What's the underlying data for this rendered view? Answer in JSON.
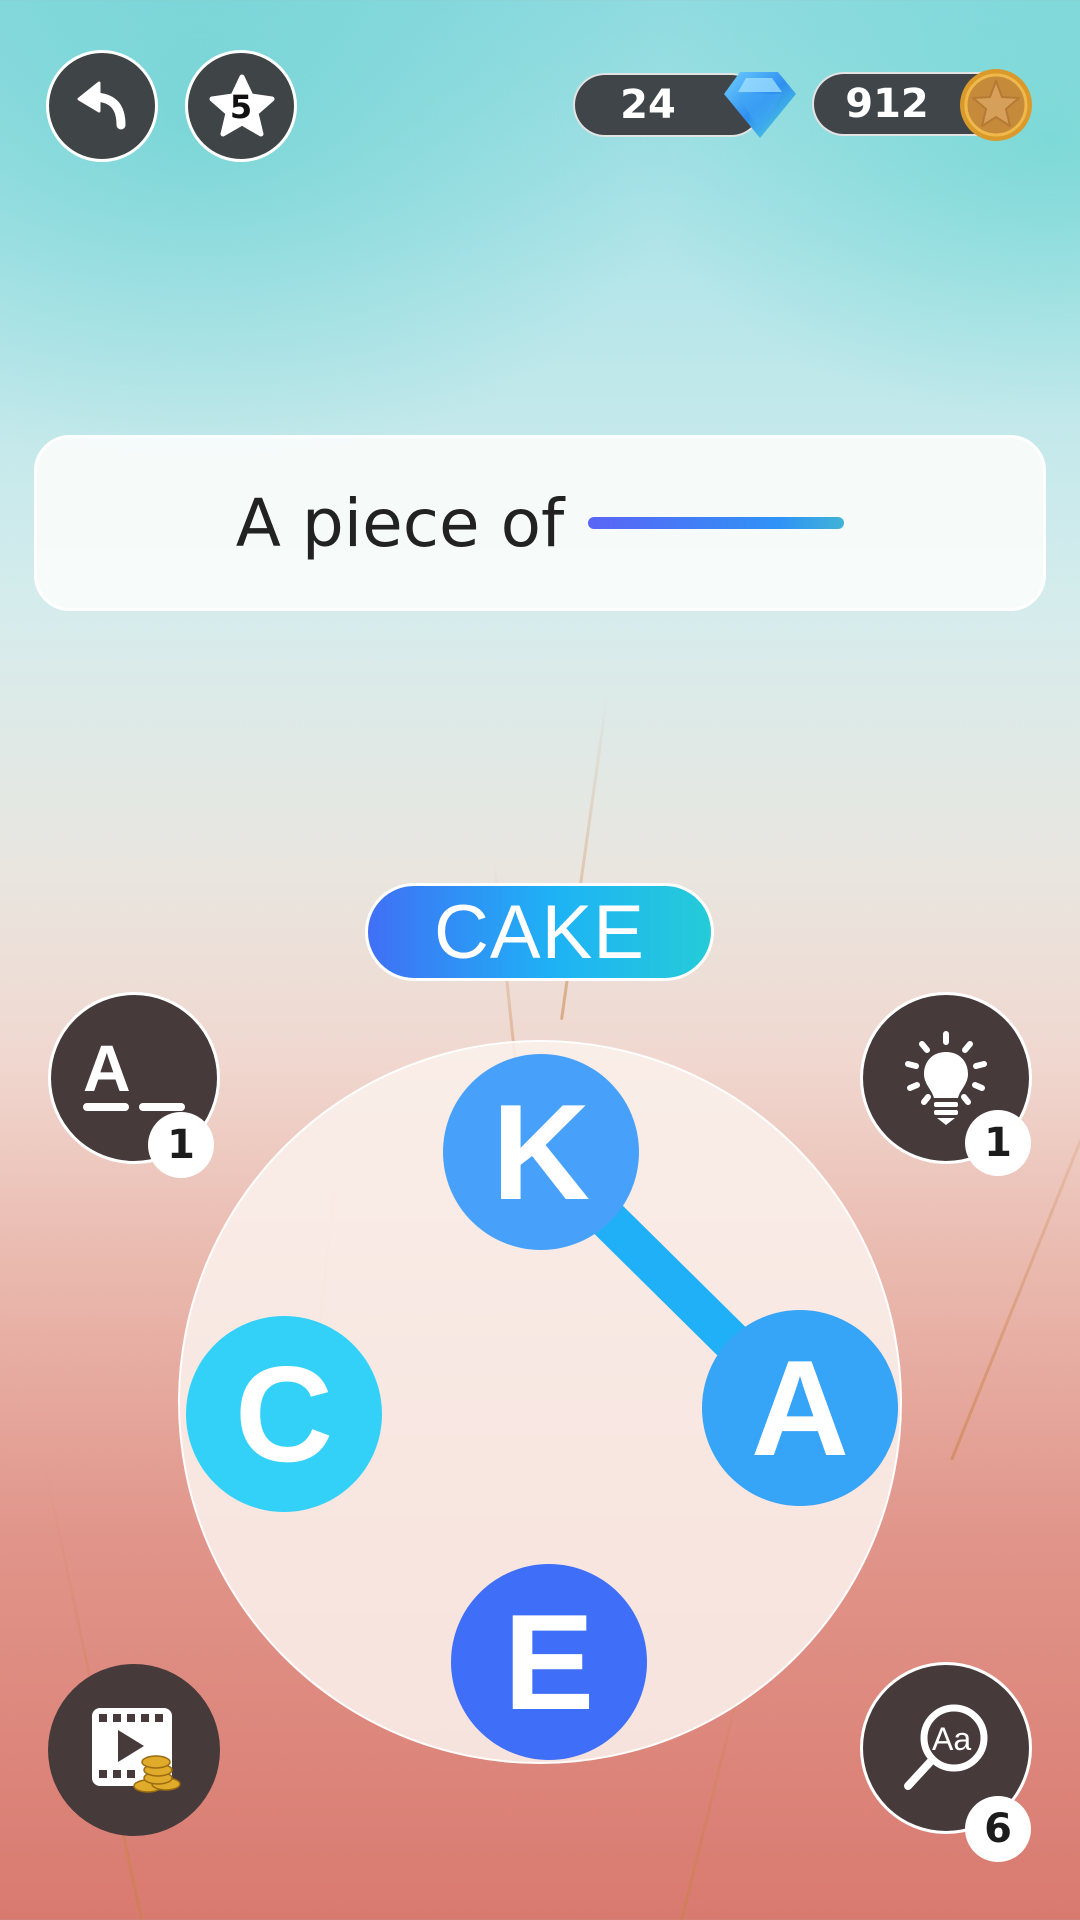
{
  "header": {
    "undo_button": {
      "icon": "undo-arrow-icon"
    },
    "level_star": {
      "icon": "star-icon",
      "value": "5"
    },
    "gems": {
      "value": "24",
      "icon": "gem-icon"
    },
    "coins": {
      "value": "912",
      "icon": "coin-star-icon"
    }
  },
  "clue": {
    "text": "A piece of",
    "blank_icon": "blank-underline"
  },
  "current_word": "CAKE",
  "wheel": {
    "letters": [
      {
        "char": "K",
        "position": "top",
        "color": "#47a1fb"
      },
      {
        "char": "A",
        "position": "right",
        "color": "#36a4f7"
      },
      {
        "char": "E",
        "position": "bottom",
        "color": "#3f6ef8"
      },
      {
        "char": "C",
        "position": "left",
        "color": "#33d1f8"
      }
    ],
    "path": [
      "C",
      "A",
      "K",
      "E"
    ]
  },
  "boosters": {
    "reveal_letter": {
      "icon": "reveal-letter-icon",
      "count": "1"
    },
    "hint": {
      "icon": "lightbulb-icon",
      "count": "1"
    },
    "watch_video": {
      "icon": "video-coins-icon"
    },
    "dictionary": {
      "icon": "search-letters-icon",
      "count": "6"
    }
  },
  "colors": {
    "button_dark": "#3f4446",
    "accent_blue": "#3f6ef8",
    "accent_cyan": "#25cbd8"
  }
}
